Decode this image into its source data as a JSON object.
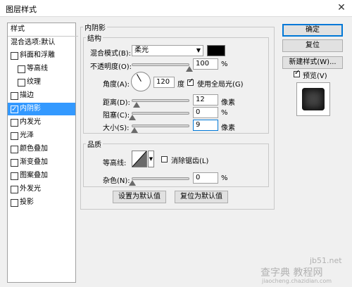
{
  "dialog": {
    "title": "图层样式",
    "close": "✕"
  },
  "styles_panel": {
    "header": "样式",
    "blend_options": "混合选项:默认",
    "items": [
      {
        "label": "斜面和浮雕",
        "checked": false
      },
      {
        "label": "等高线",
        "checked": false
      },
      {
        "label": "纹理",
        "checked": false
      },
      {
        "label": "描边",
        "checked": false
      },
      {
        "label": "内阴影",
        "checked": true
      },
      {
        "label": "内发光",
        "checked": false
      },
      {
        "label": "光泽",
        "checked": false
      },
      {
        "label": "颜色叠加",
        "checked": false
      },
      {
        "label": "渐变叠加",
        "checked": false
      },
      {
        "label": "图案叠加",
        "checked": false
      },
      {
        "label": "外发光",
        "checked": false
      },
      {
        "label": "投影",
        "checked": false
      }
    ]
  },
  "inner_shadow": {
    "title": "内阴影",
    "structure": {
      "title": "结构",
      "blend_mode_label": "混合模式(B):",
      "blend_mode_value": "柔光",
      "opacity_label": "不透明度(O):",
      "opacity_value": "100",
      "opacity_unit": "%",
      "angle_label": "角度(A):",
      "angle_value": "120",
      "angle_unit": "度",
      "global_light_label": "使用全局光(G)",
      "global_light_checked": true,
      "distance_label": "距离(D):",
      "distance_value": "12",
      "distance_unit": "像素",
      "choke_label": "阻塞(C):",
      "choke_value": "0",
      "choke_unit": "%",
      "size_label": "大小(S):",
      "size_value": "9",
      "size_unit": "像素"
    },
    "quality": {
      "title": "品质",
      "contour_label": "等高线:",
      "antialias_label": "消除锯齿(L)",
      "antialias_checked": false,
      "noise_label": "杂色(N):",
      "noise_value": "0",
      "noise_unit": "%"
    },
    "set_default": "设置为默认值",
    "reset_default": "复位为默认值"
  },
  "buttons": {
    "ok": "确定",
    "reset": "复位",
    "new_style": "新建样式(W)...",
    "preview_label": "预览(V)",
    "preview_checked": true
  },
  "watermark": {
    "line1": "jb51.net",
    "line2": "查字典 教程网",
    "line3": "jiaocheng.chazidian.com"
  }
}
